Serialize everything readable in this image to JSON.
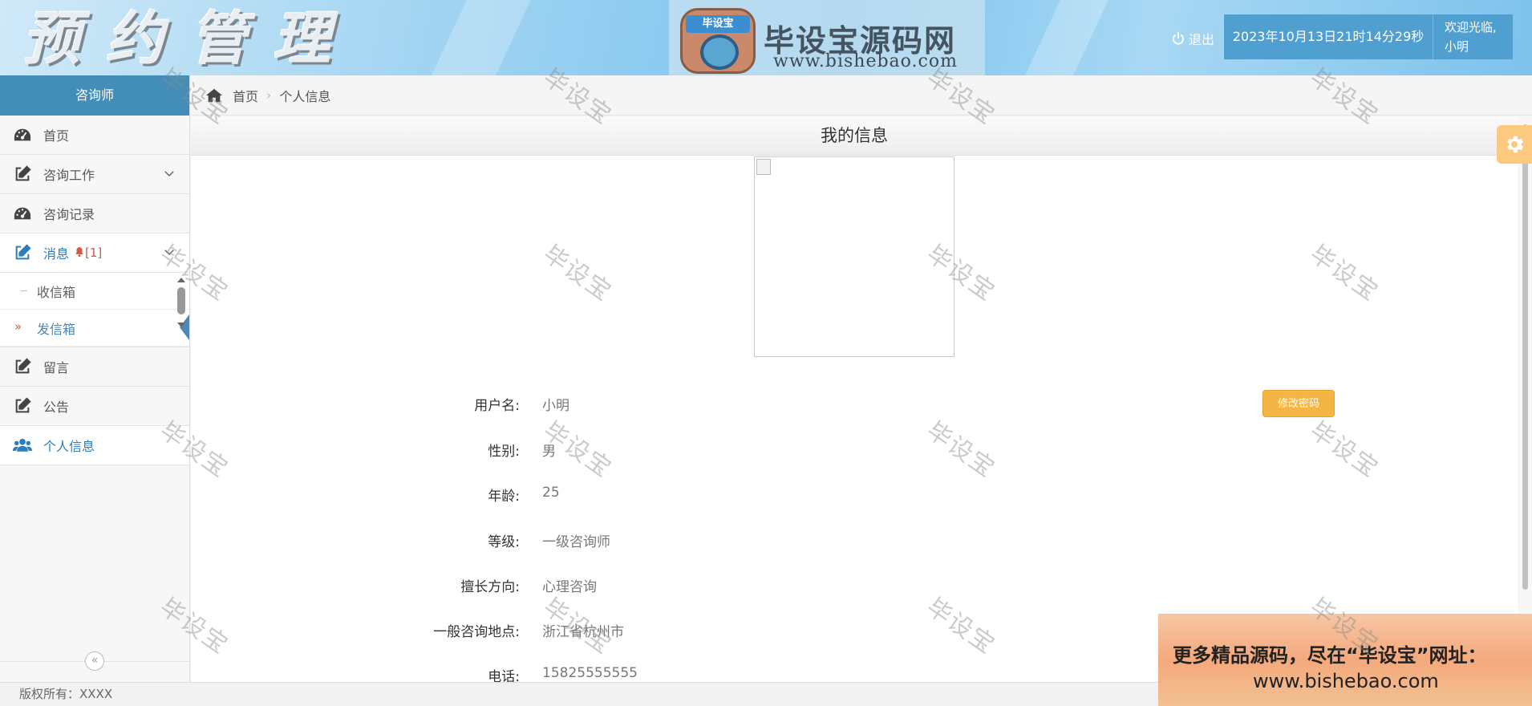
{
  "header": {
    "app_title": "预约管理",
    "logo_tag": "毕设宝",
    "logo_name": "毕设宝源码网",
    "logo_url": "www.bishebao.com",
    "logout_label": "退出",
    "datetime": "2023年10月13日21时14分29秒",
    "welcome_line1": "欢迎光临,",
    "welcome_line2": "小明"
  },
  "sidebar": {
    "role": "咨询师",
    "items": [
      {
        "label": "首页",
        "icon": "dashboard-icon"
      },
      {
        "label": "咨询工作",
        "icon": "edit-icon",
        "expandable": true
      },
      {
        "label": "咨询记录",
        "icon": "dashboard-icon"
      },
      {
        "label": "消息",
        "icon": "edit-icon",
        "expandable": true,
        "badge": "[1]"
      },
      {
        "label": "留言",
        "icon": "edit-icon"
      },
      {
        "label": "公告",
        "icon": "edit-icon"
      },
      {
        "label": "个人信息",
        "icon": "users-icon"
      }
    ],
    "message_submenu": [
      {
        "label": "收信箱"
      },
      {
        "label": "发信箱"
      }
    ]
  },
  "breadcrumb": {
    "home": "首页",
    "current": "个人信息"
  },
  "main": {
    "panel_title": "我的信息",
    "change_password_label": "修改密码",
    "fields": [
      {
        "label": "用户名:",
        "value": "小明"
      },
      {
        "label": "性别:",
        "value": "男"
      },
      {
        "label": "年龄:",
        "value": "25"
      },
      {
        "label": "等级:",
        "value": "一级咨询师"
      },
      {
        "label": "擅长方向:",
        "value": "心理咨询"
      },
      {
        "label": "一般咨询地点:",
        "value": "浙江省杭州市"
      },
      {
        "label": "电话:",
        "value": "15825555555"
      }
    ]
  },
  "footer": {
    "copyright": "版权所有：XXXX"
  },
  "promo": {
    "line1": "更多精品源码，尽在“毕设宝”网址：",
    "line2": "www.bishebao.com"
  },
  "watermark_text": "毕设宝",
  "colors": {
    "accent": "#438eb9",
    "active_text": "#2b7dbc",
    "password_button": "#f3b544",
    "badge": "#d15b47"
  }
}
